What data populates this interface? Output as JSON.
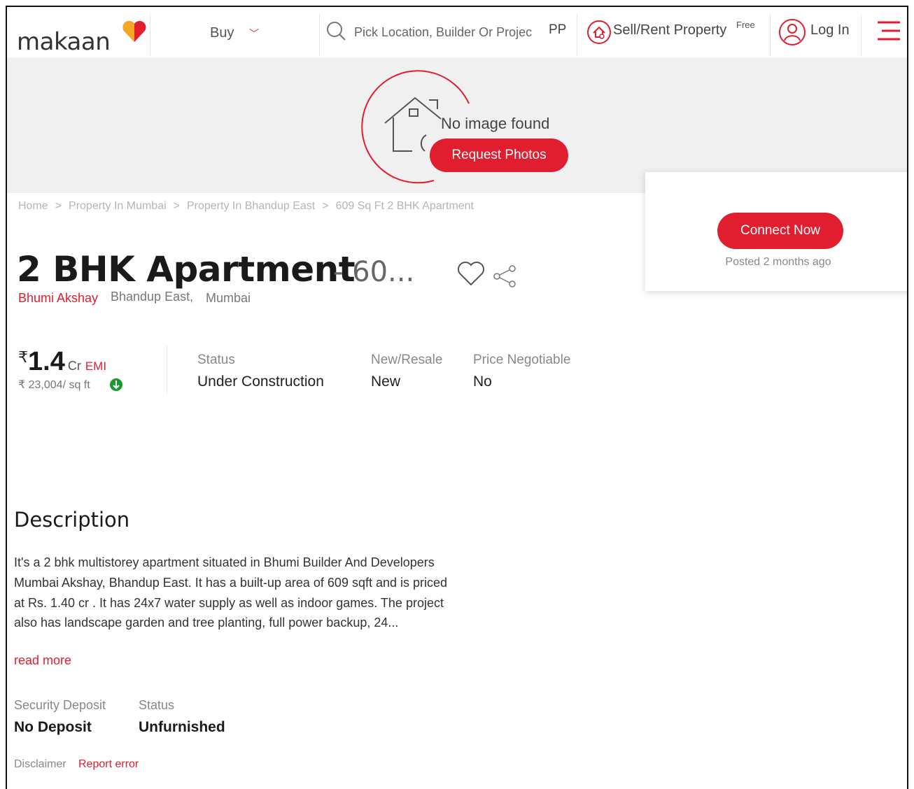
{
  "header": {
    "logo_text": "makaan",
    "buy_label": "Buy",
    "search_placeholder": "Pick Location, Builder Or Projec",
    "search_suffix": "PP",
    "sell_label": "Sell/Rent Property",
    "free_badge": "Free",
    "login_label": "Log In"
  },
  "hero": {
    "no_image_text": "No image found",
    "request_photos_label": "Request Photos"
  },
  "breadcrumb": [
    "Home",
    "Property In Mumbai",
    "Property In Bhandup East",
    "609 Sq Ft 2 BHK Apartment"
  ],
  "breadcrumb_separator": ">",
  "listing": {
    "title": "2 BHK Apartment",
    "title_size": "- 60...",
    "project": "Bhumi Akshay",
    "locality": "Bhandup East,",
    "city": "Mumbai"
  },
  "price": {
    "currency": "₹",
    "value": "1.4",
    "unit": "Cr",
    "emi_label": "EMI",
    "rate": "₹ 23,004/ sq ft"
  },
  "attributes": [
    {
      "label": "Status",
      "value": "Under Construction"
    },
    {
      "label": "New/Resale",
      "value": "New"
    },
    {
      "label": "Price Negotiable",
      "value": "No"
    }
  ],
  "card": {
    "connect_label": "Connect Now",
    "posted_text": "Posted 2 months ago"
  },
  "description": {
    "heading": "Description",
    "body": "It's a 2 bhk multistorey apartment situated in Bhumi Builder And Developers Mumbai Akshay, Bhandup East. It has a built-up area of 609 sqft and is priced at Rs. 1.40 cr . It has 24x7 water supply as well as indoor games. The project also has landscape garden and tree planting, full power backup, 24...",
    "read_more": "read more"
  },
  "details": [
    {
      "label": "Security Deposit",
      "value": "No Deposit"
    },
    {
      "label": "Status",
      "value": "Unfurnished"
    }
  ],
  "footer": {
    "disclaimer": "Disclaimer",
    "report_error": "Report error"
  },
  "colors": {
    "accent": "#e11e2f",
    "hero_bg": "#f0f0f0",
    "rate_indicator": "#1a9a2e"
  },
  "icons": [
    "heart-logo-icon",
    "chevron-down-icon",
    "search-icon",
    "sell-home-icon",
    "user-icon",
    "hamburger-menu-icon",
    "house-placeholder-icon",
    "favorite-heart-icon",
    "share-icon",
    "price-down-arrow-icon"
  ]
}
